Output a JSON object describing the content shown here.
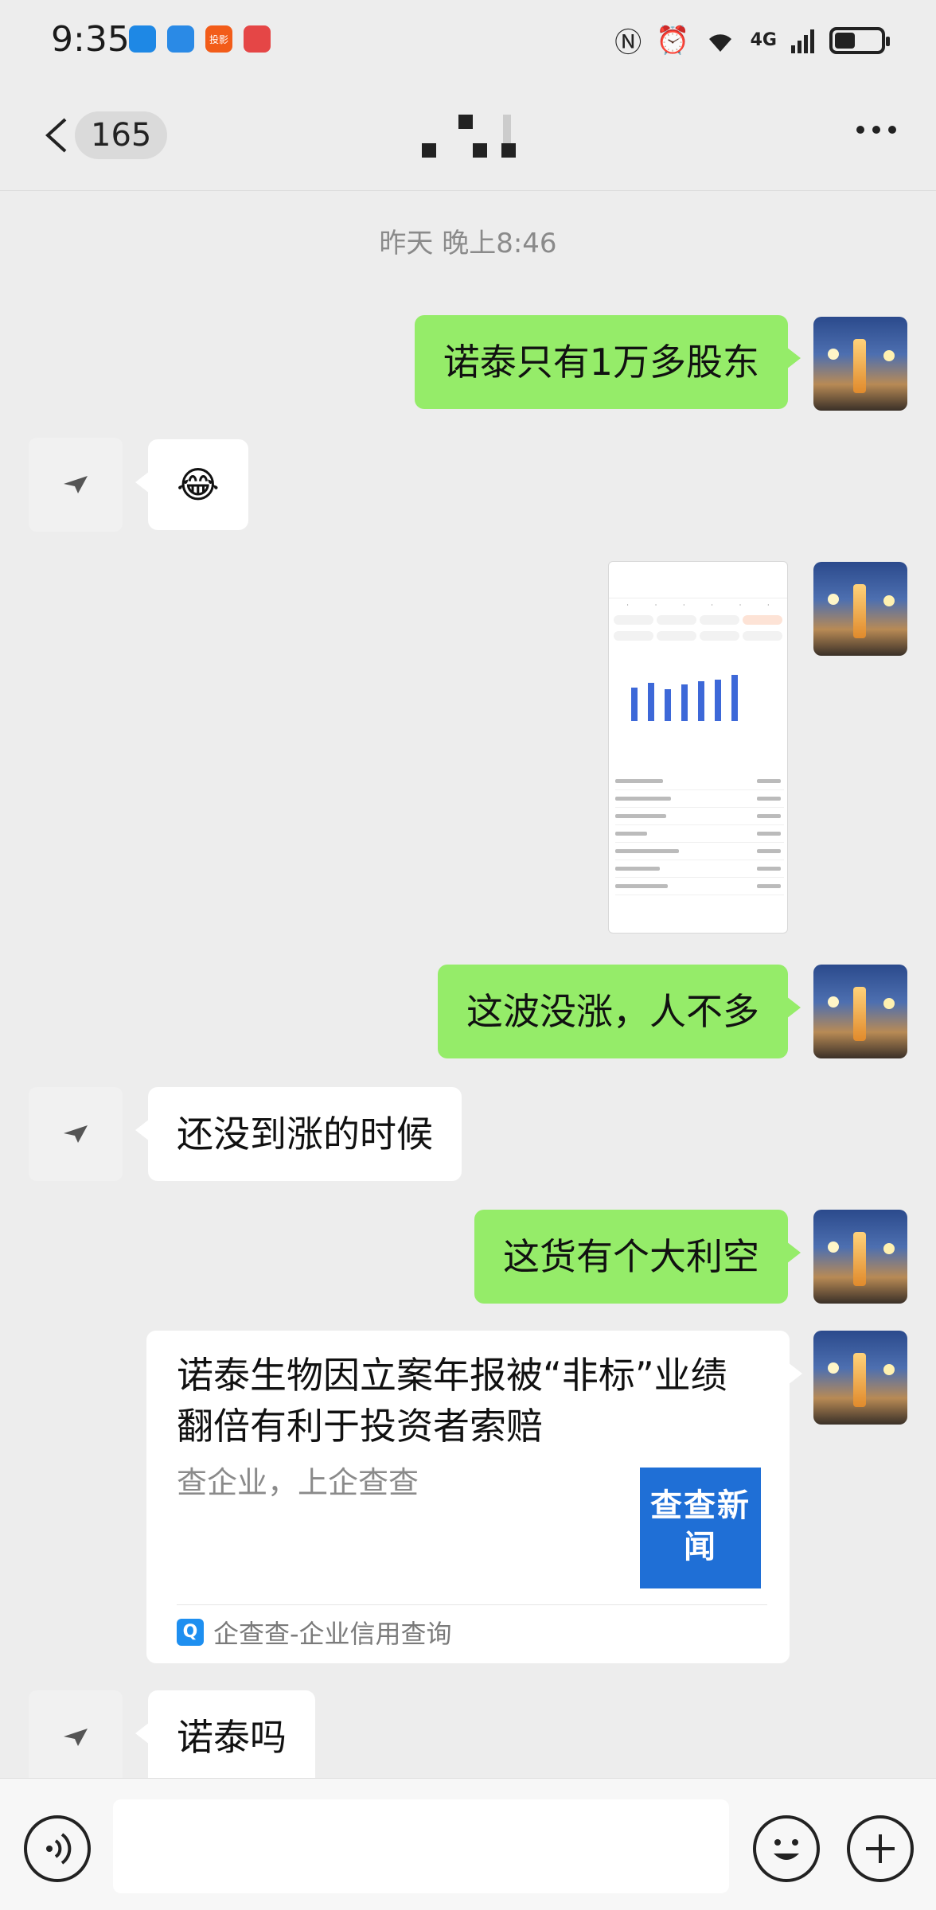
{
  "status_bar": {
    "time": "9:35",
    "app_icons": [
      {
        "icon": "wps-icon",
        "label": "",
        "color": "#1e88e5"
      },
      {
        "icon": "browser-icon",
        "label": "",
        "color": "#2a8ae6"
      },
      {
        "icon": "stock-app-icon",
        "label": "投影",
        "color": "#f25c19"
      },
      {
        "icon": "reader-icon",
        "label": "",
        "color": "#e54646"
      }
    ],
    "network": "4G",
    "battery_level": 0.45
  },
  "nav": {
    "unread_count": "165",
    "title": ""
  },
  "chat": {
    "timestamp": "昨天 晚上8:46",
    "messages": [
      {
        "from": "me",
        "type": "text",
        "text": "诺泰只有1万多股东"
      },
      {
        "from": "other",
        "type": "text",
        "text": "😂"
      },
      {
        "from": "me",
        "type": "image",
        "alt": "stock-screenshot"
      },
      {
        "from": "me",
        "type": "text",
        "text": "这波没涨，人不多"
      },
      {
        "from": "other",
        "type": "text",
        "text": "还没到涨的时候"
      },
      {
        "from": "me",
        "type": "text",
        "text": "这货有个大利空"
      },
      {
        "from": "me",
        "type": "link",
        "title": "诺泰生物因立案年报被“非标”业绩翻倍有利于投资者索赔",
        "description": "查企业，上企查查",
        "thumb_text": "查查新闻",
        "source": "企查查-企业信用查询"
      },
      {
        "from": "other",
        "type": "text",
        "text": "诺泰吗"
      }
    ]
  },
  "input_bar": {
    "placeholder": ""
  },
  "colors": {
    "my_bubble": "#95ec69",
    "other_bubble": "#ffffff",
    "background": "#ededed"
  }
}
